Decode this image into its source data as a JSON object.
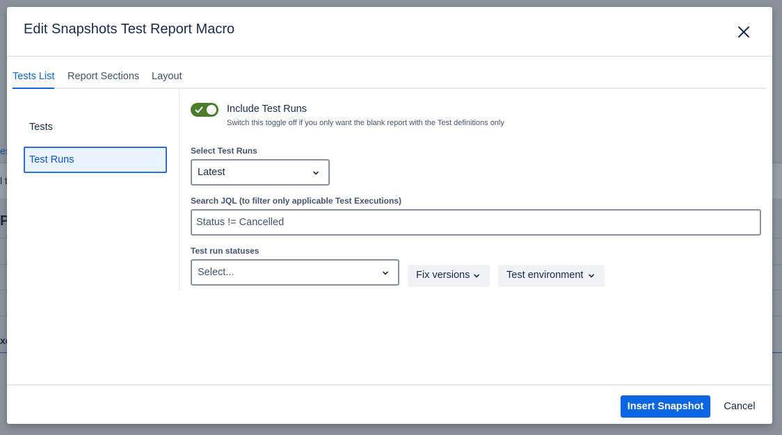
{
  "background": {
    "fragments": [
      "es",
      "l t",
      "PL",
      "xe"
    ]
  },
  "modal": {
    "title": "Edit Snapshots Test Report Macro",
    "close_icon": "close-icon"
  },
  "tabs": [
    {
      "label": "Tests List",
      "active": true
    },
    {
      "label": "Report Sections",
      "active": false
    },
    {
      "label": "Layout",
      "active": false
    }
  ],
  "sidebar": {
    "items": [
      {
        "label": "Tests",
        "active": false
      },
      {
        "label": "Test Runs",
        "active": true
      }
    ]
  },
  "content": {
    "toggle": {
      "label": "Include Test Runs",
      "help": "Switch this toggle off if you only want the blank report with the Test definitions only",
      "on": true,
      "color": "#4b7d2c"
    },
    "select_test_runs": {
      "label": "Select Test Runs",
      "value": "Latest"
    },
    "search_jql": {
      "label": "Search JQL (to filter only applicable Test Executions)",
      "value": "Status != Cancelled"
    },
    "test_run_statuses": {
      "label": "Test run statuses",
      "placeholder": "Select..."
    },
    "filters": [
      {
        "label": "Fix versions"
      },
      {
        "label": "Test environment"
      }
    ]
  },
  "footer": {
    "insert_label": "Insert Snapshot",
    "cancel_label": "Cancel",
    "primary_color": "#0c66e4"
  }
}
